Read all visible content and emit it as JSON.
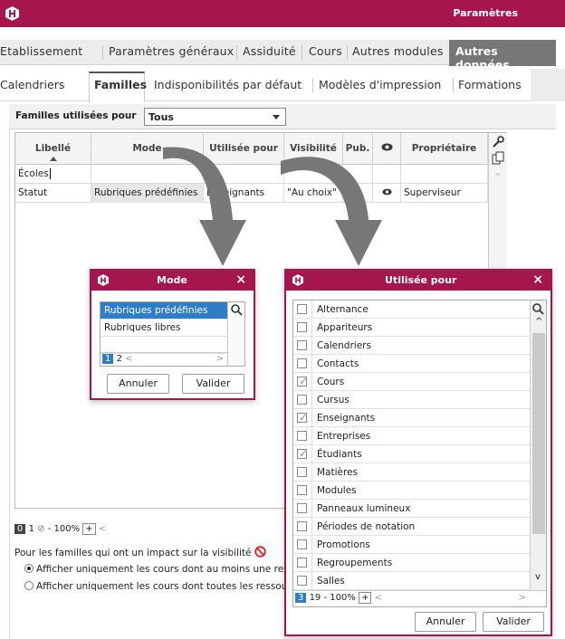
{
  "window": {
    "title": "Paramètres"
  },
  "tabs1": [
    "Etablissement",
    "Paramètres généraux",
    "Assiduité",
    "Cours",
    "Autres modules"
  ],
  "tabs1_active": "Autres données",
  "tabs2": [
    "Calendriers",
    "Familles",
    "Indisponibilités par défaut",
    "Modèles d'impression",
    "Formations"
  ],
  "filter": {
    "label": "Familles utilisées pour",
    "value": "Tous"
  },
  "grid": {
    "headers": [
      "Libellé",
      "Mode",
      "Utilisée pour",
      "Visibilité",
      "Pub.",
      "Propriétaire"
    ],
    "rows": [
      {
        "libelle": "Écoles",
        "mode": "",
        "utilisee": "",
        "visibilite": "",
        "pub": "",
        "eye": false,
        "proprietaire": ""
      },
      {
        "libelle": "Statut",
        "mode": "Rubriques prédéfinies",
        "utilisee": "Enseignants",
        "visibilite": "\"Au choix\"",
        "pub": "",
        "eye": true,
        "proprietaire": "Superviseur"
      }
    ]
  },
  "footer": {
    "page_current": "0",
    "page_total": "1",
    "zoom": "100%",
    "note": "Pour les familles qui ont un impact sur la visibilité",
    "radio1": "Afficher uniquement les cours dont au moins une resso",
    "radio2": "Afficher uniquement les cours dont toutes les ressour"
  },
  "mode_dialog": {
    "title": "Mode",
    "items": [
      "Rubriques prédéfinies",
      "Rubriques libres"
    ],
    "page_current": "1",
    "page_total": "2",
    "cancel": "Annuler",
    "ok": "Valider"
  },
  "use_dialog": {
    "title": "Utilisée pour",
    "items": [
      {
        "label": "Alternance",
        "checked": false
      },
      {
        "label": "Appariteurs",
        "checked": false
      },
      {
        "label": "Calendriers",
        "checked": false
      },
      {
        "label": "Contacts",
        "checked": false
      },
      {
        "label": "Cours",
        "checked": true
      },
      {
        "label": "Cursus",
        "checked": false
      },
      {
        "label": "Enseignants",
        "checked": true
      },
      {
        "label": "Entreprises",
        "checked": false
      },
      {
        "label": "Étudiants",
        "checked": true
      },
      {
        "label": "Matières",
        "checked": false
      },
      {
        "label": "Modules",
        "checked": false
      },
      {
        "label": "Panneaux lumineux",
        "checked": false
      },
      {
        "label": "Périodes de notation",
        "checked": false
      },
      {
        "label": "Promotions",
        "checked": false
      },
      {
        "label": "Regroupements",
        "checked": false
      },
      {
        "label": "Salles",
        "checked": false
      }
    ],
    "page_current": "3",
    "page_total": "19",
    "zoom": "100%",
    "cancel": "Annuler",
    "ok": "Valider"
  },
  "colors": {
    "brand": "#a5164c",
    "accent": "#2f7ec5",
    "check": "#6ab04c"
  }
}
